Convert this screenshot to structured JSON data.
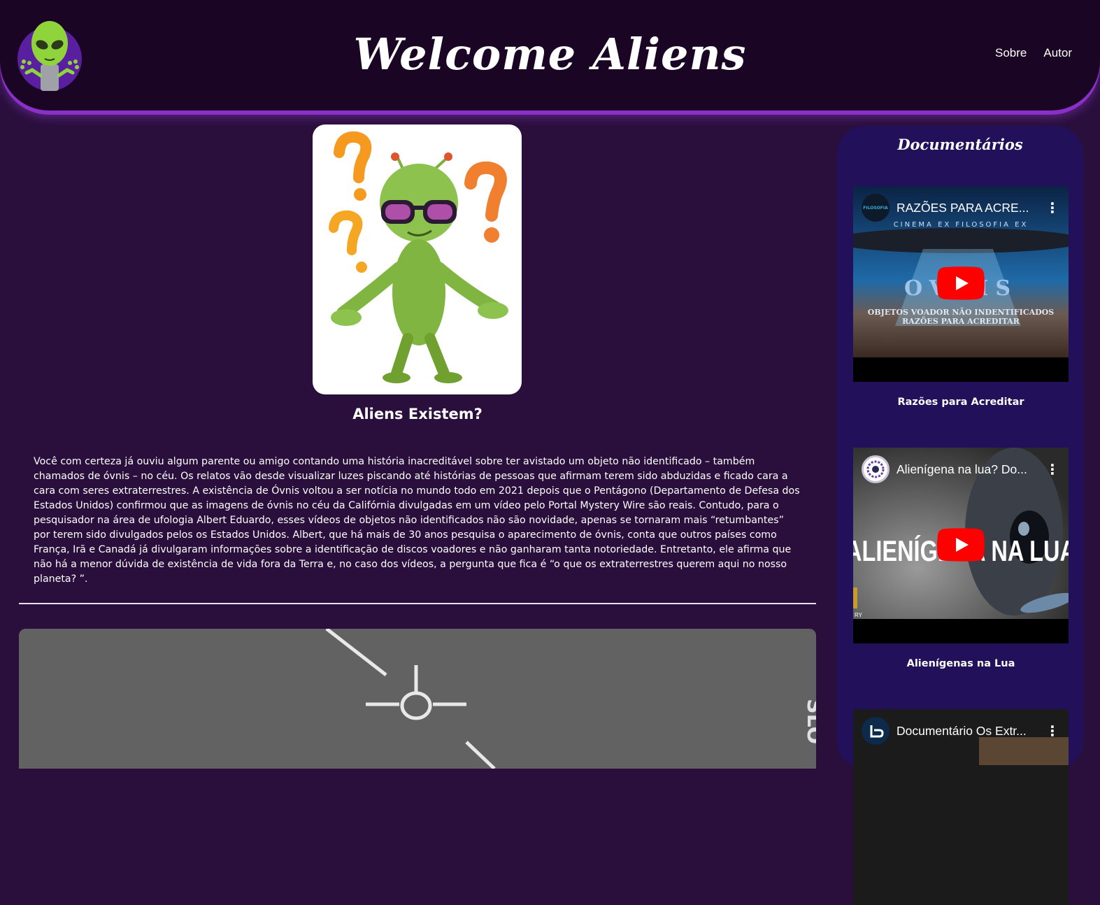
{
  "header": {
    "title": "Welcome Aliens",
    "nav": [
      "Sobre",
      "Autor"
    ]
  },
  "main": {
    "hero_title": "Aliens Existem?",
    "article": "Você com certeza já ouviu algum parente ou amigo contando uma história inacreditável sobre ter avistado um objeto não identificado – também chamados de óvnis – no céu. Os relatos vão desde visualizar luzes piscando até histórias de pessoas que afirmam terem sido abduzidas e ficado cara a cara com seres extraterrestres. A existência de Óvnis voltou a ser notícia no mundo todo em 2021 depois que o Pentágono (Departamento de Defesa dos Estados Unidos) confirmou que as imagens de óvnis no céu da Califórnia divulgadas em um vídeo pelo Portal Mystery Wire são reais. Contudo, para o pesquisador na área de ufologia Albert Eduardo, esses vídeos de objetos não identificados não são novidade, apenas se tornaram mais “retumbantes” por terem sido divulgados pelos os Estados Unidos. Albert, que há mais de 30 anos pesquisa o aparecimento de óvnis, conta que outros países como França, Irã e Canadá já divulgaram informações sobre a identificação de discos voadores e não ganharam tanta notoriedade. Entretanto, ele afirma que não há a menor dúvida de existência de vida fora da Terra e, no caso dos vídeos, a pergunta que fica é “o que os extraterrestres querem aqui no nosso planeta? ”.",
    "video_overlay_text": "SLO"
  },
  "sidebar": {
    "title": "Documentários",
    "docs": [
      {
        "video_title": "RAZÕES PARA ACRE...",
        "channel_text": "FILOSOFIA",
        "thumb_tagline": "CINEMA EX FILOSOFIA EX",
        "thumb_big": "OVNIS",
        "thumb_caption_1": "OBJETOS VOADOR NÃO INDENTIFICADOS",
        "thumb_caption_2": "RAZÕES PARA ACREDITAR",
        "label": "Razões para Acreditar"
      },
      {
        "video_title": "Alienígena na lua? Do...",
        "thumb_big": "ALIENÍGENA NA LUA",
        "thumb_corner": "RY",
        "label": "Alienígenas na Lua"
      },
      {
        "video_title": "Documentário Os Extr...",
        "label": ""
      }
    ]
  },
  "colors": {
    "page_bg": "#2a0f3d",
    "header_bg": "#1a0524",
    "header_glow": "#8b2fc9",
    "sidebar_bg": "#22105a",
    "youtube_red": "#ff0000"
  },
  "icons": [
    "alien-logo-icon",
    "youtube-play-icon",
    "more-vert-icon"
  ]
}
